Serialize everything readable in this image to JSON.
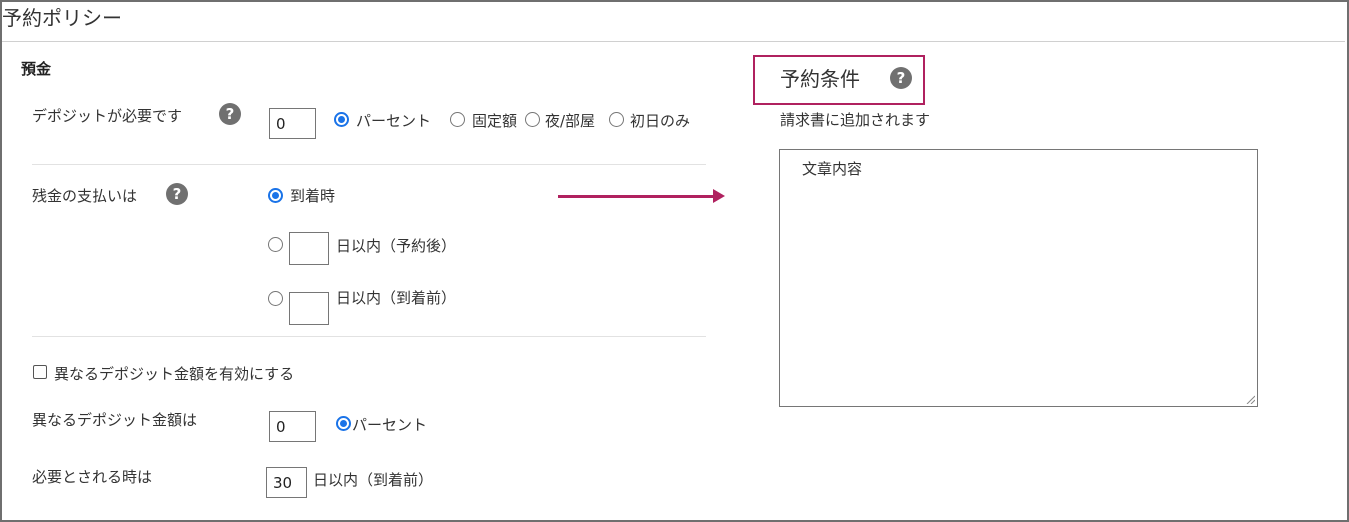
{
  "header": {
    "title": "予約ポリシー"
  },
  "deposit": {
    "section_label": "預金",
    "required_label": "デポジットが必要です",
    "help_glyph": "?",
    "amount_value": "0",
    "options": [
      "パーセント",
      "固定額",
      "夜/部屋",
      "初日のみ"
    ],
    "selected": "パーセント"
  },
  "balance": {
    "label": "残金の支払いは",
    "help_glyph": "?",
    "option_arrival": "到着時",
    "option_after_booking": "日以内（予約後）",
    "option_before_arrival": "日以内（到着前）",
    "after_booking_value": "",
    "before_arrival_value": "",
    "selected": "到着時"
  },
  "alt_deposit": {
    "enable_label": "異なるデポジット金額を有効にする",
    "enabled": false,
    "amount_label": "異なるデポジット金額は",
    "amount_value": "0",
    "unit_option": "パーセント",
    "required_when_label": "必要とされる時は",
    "days_value": "30",
    "days_suffix": "日以内（到着前）"
  },
  "conditions": {
    "title": "予約条件",
    "help_glyph": "?",
    "subtitle": "請求書に追加されます",
    "textarea_value": "文章内容"
  },
  "colors": {
    "accent": "#1a73e8",
    "highlight": "#b0215f",
    "help_icon": "#707070",
    "border": "#6f6f6f"
  }
}
